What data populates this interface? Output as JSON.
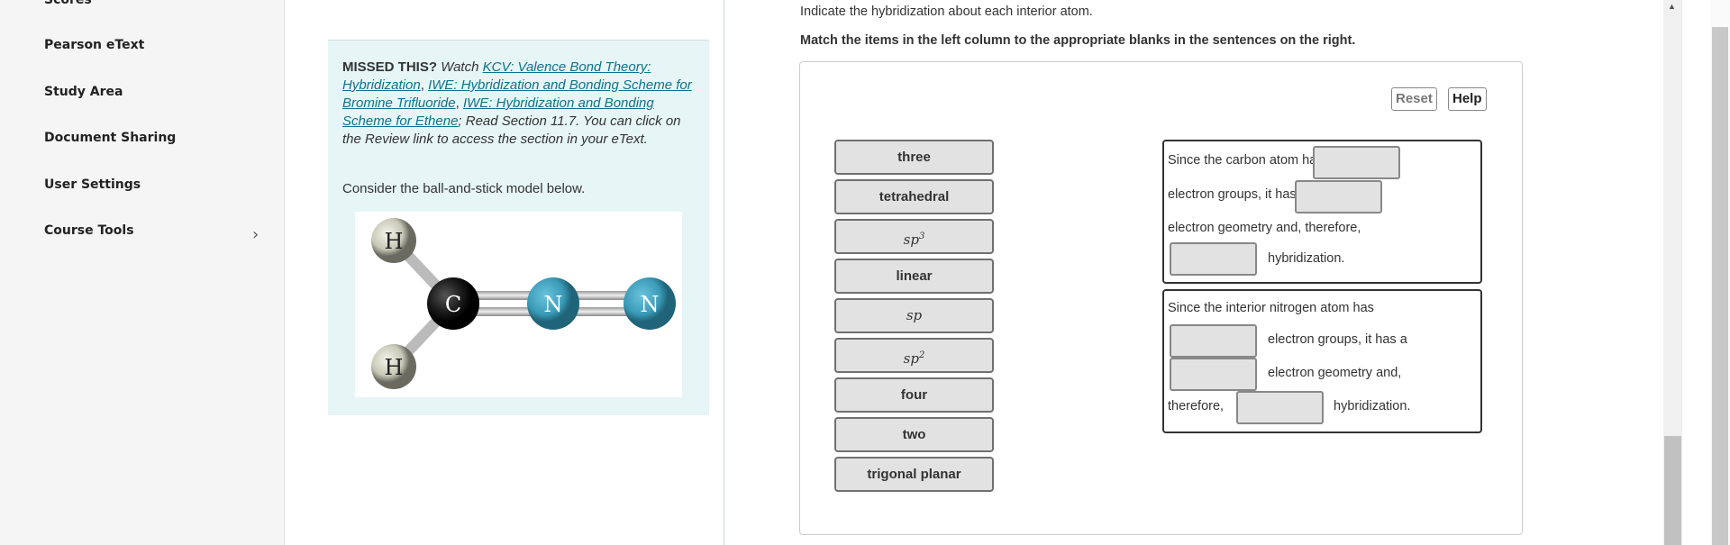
{
  "sidebar": {
    "items": [
      {
        "label": "Scores"
      },
      {
        "label": "Pearson eText"
      },
      {
        "label": "Study Area"
      },
      {
        "label": "Document Sharing"
      },
      {
        "label": "User Settings"
      },
      {
        "label": "Course Tools",
        "icon": "chevron-right-icon"
      }
    ]
  },
  "missed": {
    "lead": "MISSED THIS?",
    "watch": "Watch",
    "links": [
      "KCV: Valence Bond Theory: Hybridization",
      "IWE: Hybridization and Bonding Scheme for Bromine Trifluoride",
      "IWE: Hybridization and Bonding Scheme for Ethene"
    ],
    "read": "; Read Section 11.7. You can click on the Review link to access the section in your eText.",
    "consider": "Consider the ball-and-stick model below.",
    "atoms": [
      "H",
      "H",
      "C",
      "N",
      "N"
    ]
  },
  "question": {
    "instruction": "Indicate the hybridization about each interior atom.",
    "match_instruction": "Match the items in the left column to the appropriate blanks in the sentences on the right.",
    "reset_label": "Reset",
    "help_label": "Help",
    "items": [
      {
        "label": "three"
      },
      {
        "label": "tetrahedral"
      },
      {
        "label": "sp",
        "sup": "3"
      },
      {
        "label": "linear"
      },
      {
        "label": "sp"
      },
      {
        "label": "sp",
        "sup": "2"
      },
      {
        "label": "four"
      },
      {
        "label": "two"
      },
      {
        "label": "trigonal planar"
      }
    ],
    "sentence1": {
      "t1": "Since the carbon atom has",
      "t2": "electron groups, it has a",
      "t3": "electron geometry and, therefore,",
      "t4": "hybridization."
    },
    "sentence2": {
      "t1": "Since the interior nitrogen atom has",
      "t2": "electron groups, it has a",
      "t3": "electron geometry and,",
      "t4": "therefore,",
      "t5": "hybridization."
    }
  },
  "colors": {
    "link": "#10728a",
    "missed_bg": "#e6f5f5",
    "nitrogen": "#3a9bb8",
    "carbon": "#1a1a1a",
    "hydrogen": "#d8d8c8"
  }
}
